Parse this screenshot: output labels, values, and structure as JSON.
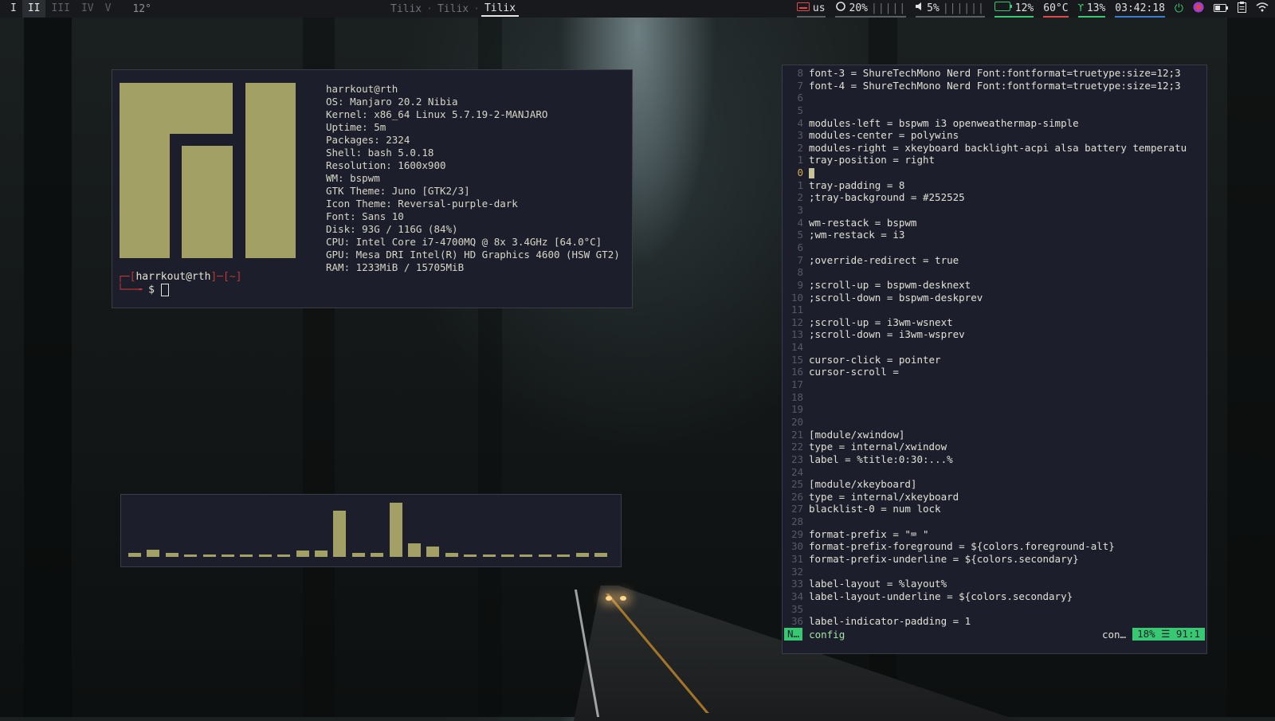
{
  "topbar": {
    "workspaces": [
      {
        "label": "I",
        "state": "occupied"
      },
      {
        "label": "II",
        "state": "active"
      },
      {
        "label": "III",
        "state": "empty"
      },
      {
        "label": "IV",
        "state": "empty"
      },
      {
        "label": "V",
        "state": "empty"
      }
    ],
    "weather_temp": "12°",
    "windows": [
      {
        "label": "Tilix",
        "active": false
      },
      {
        "label": "Tilix",
        "active": false
      },
      {
        "label": "Tilix",
        "active": true
      }
    ],
    "window_separator": "·",
    "keyboard": "us",
    "backlight": "20%",
    "backlight_bars": "|||||",
    "volume": "5%",
    "volume_bars": "||||||",
    "battery": "12%",
    "temperature": "60°C",
    "cpu": "13%",
    "clock": "03:42:18"
  },
  "neofetch": {
    "user_host": "harrkout@rth",
    "lines": [
      "OS: Manjaro 20.2 Nibia",
      "Kernel: x86_64 Linux 5.7.19-2-MANJARO",
      "Uptime: 5m",
      "Packages: 2324",
      "Shell: bash 5.0.18",
      "Resolution: 1600x900",
      "WM: bspwm",
      "GTK Theme: Juno [GTK2/3]",
      "Icon Theme: Reversal-purple-dark",
      "Font: Sans 10",
      "Disk: 93G / 116G (84%)",
      "CPU: Intel Core i7-4700MQ @ 8x 3.4GHz [64.0°C]",
      "GPU: Mesa DRI Intel(R) HD Graphics 4600 (HSW GT2)",
      "RAM: 1233MiB / 15705MiB"
    ],
    "prompt_user": "harrkout@rth",
    "prompt_dir": "~",
    "prompt_symbol": "$"
  },
  "visualizer": {
    "levels": [
      0.08,
      0.13,
      0.08,
      0.03,
      0.03,
      0.03,
      0.03,
      0.03,
      0.03,
      0.12,
      0.12,
      0.86,
      0.08,
      0.08,
      1.0,
      0.25,
      0.19,
      0.08,
      0.03,
      0.03,
      0.03,
      0.03,
      0.03,
      0.03,
      0.08,
      0.08
    ],
    "color": "#a3a066"
  },
  "editor": {
    "lines": [
      {
        "num": "8",
        "text": "font-3 = ShureTechMono Nerd Font:fontformat=truetype:size=12;3"
      },
      {
        "num": "7",
        "text": "font-4 = ShureTechMono Nerd Font:fontformat=truetype:size=12;3"
      },
      {
        "num": "6",
        "text": ""
      },
      {
        "num": "5",
        "text": ""
      },
      {
        "num": "4",
        "text": "modules-left = bspwm i3 openweathermap-simple"
      },
      {
        "num": "3",
        "text": "modules-center = polywins"
      },
      {
        "num": "2",
        "text": "modules-right = xkeyboard backlight-acpi alsa battery temperatu"
      },
      {
        "num": "1",
        "text": "tray-position = right"
      },
      {
        "num": "0",
        "text": "",
        "current": true
      },
      {
        "num": "1",
        "text": "tray-padding = 8"
      },
      {
        "num": "2",
        "text": ";tray-background = #252525"
      },
      {
        "num": "3",
        "text": ""
      },
      {
        "num": "4",
        "text": "wm-restack = bspwm"
      },
      {
        "num": "5",
        "text": ";wm-restack = i3"
      },
      {
        "num": "6",
        "text": ""
      },
      {
        "num": "7",
        "text": ";override-redirect = true"
      },
      {
        "num": "8",
        "text": ""
      },
      {
        "num": "9",
        "text": ";scroll-up = bspwm-desknext"
      },
      {
        "num": "10",
        "text": ";scroll-down = bspwm-deskprev"
      },
      {
        "num": "11",
        "text": ""
      },
      {
        "num": "12",
        "text": ";scroll-up = i3wm-wsnext"
      },
      {
        "num": "13",
        "text": ";scroll-down = i3wm-wsprev"
      },
      {
        "num": "14",
        "text": ""
      },
      {
        "num": "15",
        "text": "cursor-click = pointer"
      },
      {
        "num": "16",
        "text": "cursor-scroll ="
      },
      {
        "num": "17",
        "text": ""
      },
      {
        "num": "18",
        "text": ""
      },
      {
        "num": "19",
        "text": ""
      },
      {
        "num": "20",
        "text": ""
      },
      {
        "num": "21",
        "text": "[module/xwindow]"
      },
      {
        "num": "22",
        "text": "type = internal/xwindow"
      },
      {
        "num": "23",
        "text": "label = %title:0:30:...%"
      },
      {
        "num": "24",
        "text": ""
      },
      {
        "num": "25",
        "text": "[module/xkeyboard]"
      },
      {
        "num": "26",
        "text": "type = internal/xkeyboard"
      },
      {
        "num": "27",
        "text": "blacklist-0 = num lock"
      },
      {
        "num": "28",
        "text": ""
      },
      {
        "num": "29",
        "text": "format-prefix = \"⌨ \""
      },
      {
        "num": "30",
        "text": "format-prefix-foreground = ${colors.foreground-alt}"
      },
      {
        "num": "31",
        "text": "format-prefix-underline = ${colors.secondary}"
      },
      {
        "num": "32",
        "text": ""
      },
      {
        "num": "33",
        "text": "label-layout = %layout%"
      },
      {
        "num": "34",
        "text": "label-layout-underline = ${colors.secondary}"
      },
      {
        "num": "35",
        "text": ""
      },
      {
        "num": "36",
        "text": "label-indicator-padding = 1"
      }
    ],
    "status": {
      "mode": "N…",
      "filename": "config",
      "filetype": "con…",
      "position": "18% ☰ 91:1"
    }
  }
}
